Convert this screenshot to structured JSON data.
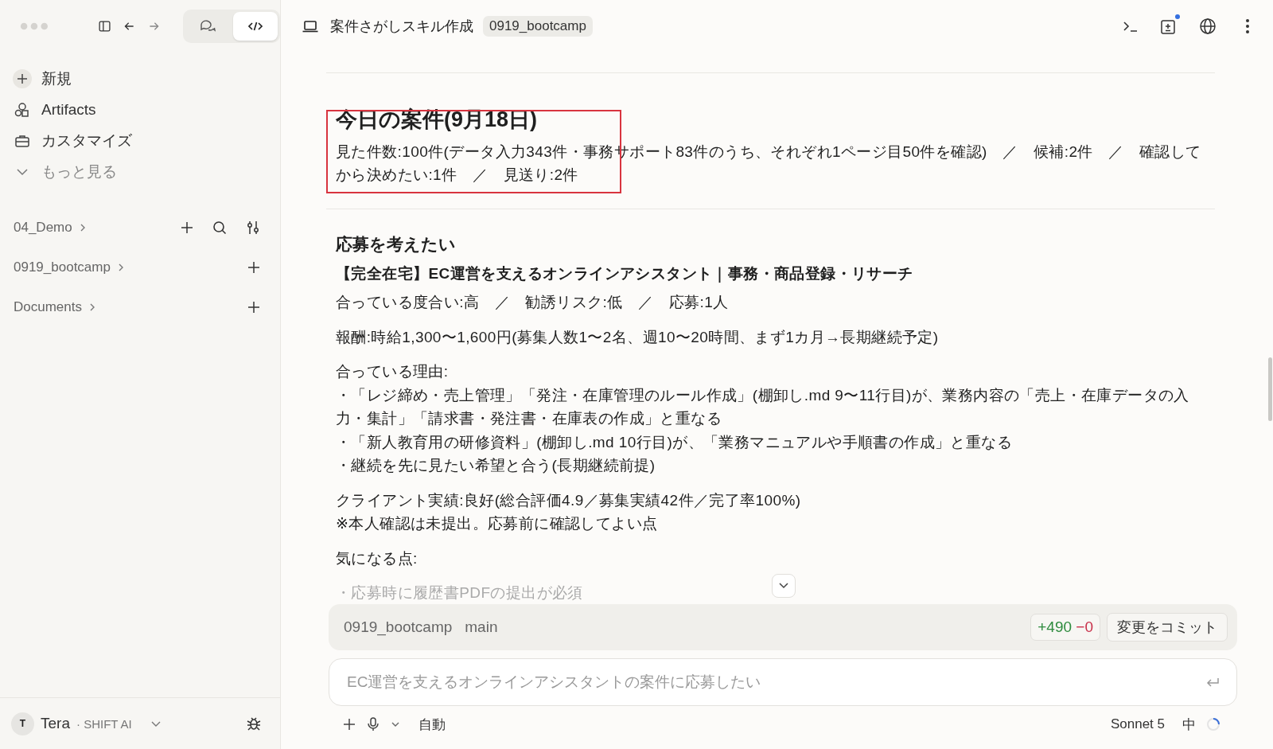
{
  "sidebar": {
    "view_modes": [
      {
        "kind": "chat",
        "selected": false
      },
      {
        "kind": "code",
        "selected": true
      }
    ],
    "nav_items": [
      {
        "kind": "new",
        "label": "新規"
      },
      {
        "kind": "artifacts",
        "label": "Artifacts"
      },
      {
        "kind": "customize",
        "label": "カスタマイズ"
      },
      {
        "kind": "more",
        "label": "もっと見る"
      }
    ],
    "projects": [
      {
        "name": "04_Demo",
        "kind": "current"
      },
      {
        "name": "0919_bootcamp",
        "kind": "plain"
      },
      {
        "name": "Documents",
        "kind": "plain"
      }
    ],
    "user": {
      "initial": "T",
      "name": "Tera",
      "org": "· SHIFT AI"
    }
  },
  "header": {
    "title": "案件さがしスキル作成",
    "badge": "0919_bootcamp",
    "update_dot": true
  },
  "document": {
    "heading": "今日の案件(9月18日)",
    "summary": "見た件数:100件(データ入力343件・事務サポート83件のうち、それぞれ1ページ目50件を確認)　／　候補:2件　／　確認してから決めたい:1件　／　見送り:2件",
    "section_heading": "応募を考えたい",
    "job_title": "【完全在宅】EC運営を支えるオンラインアシスタント｜事務・商品登録・リサーチ",
    "paragraphs": [
      {
        "lines": [
          "合っている度合い:高　／　勧誘リスク:低　／　応募:1人"
        ],
        "faded": false
      },
      {
        "lines": [
          "報酬:時給1,300〜1,600円(募集人数1〜2名、週10〜20時間、まず1カ月→長期継続予定)"
        ],
        "faded": false
      },
      {
        "lines": [
          "合っている理由:",
          "・「レジ締め・売上管理」「発注・在庫管理のルール作成」(棚卸し.md 9〜11行目)が、業務内容の「売上・在庫データの入力・集計」「請求書・発注書・在庫表の作成」と重なる",
          "・「新人教育用の研修資料」(棚卸し.md 10行目)が、「業務マニュアルや手順書の作成」と重なる",
          "・継続を先に見たい希望と合う(長期継続前提)"
        ],
        "faded": false
      },
      {
        "lines": [
          "クライアント実績:良好(総合評価4.9／募集実績42件／完了率100%)",
          "※本人確認は未提出。応募前に確認してよい点"
        ],
        "faded": false
      },
      {
        "lines": [
          "気になる点:"
        ],
        "faded": false
      },
      {
        "lines": [
          "・応募時に履歴書PDFの提出が必須"
        ],
        "faded": true
      }
    ]
  },
  "git_bar": {
    "repo": "0919_bootcamp",
    "branch": "main",
    "additions": "+490",
    "deletions": "−0",
    "commit_label": "変更をコミット"
  },
  "composer": {
    "placeholder": "EC運営を支えるオンラインアシスタントの案件に応募したい",
    "mode": "自動",
    "model": "Sonnet 5",
    "effort": "中"
  }
}
